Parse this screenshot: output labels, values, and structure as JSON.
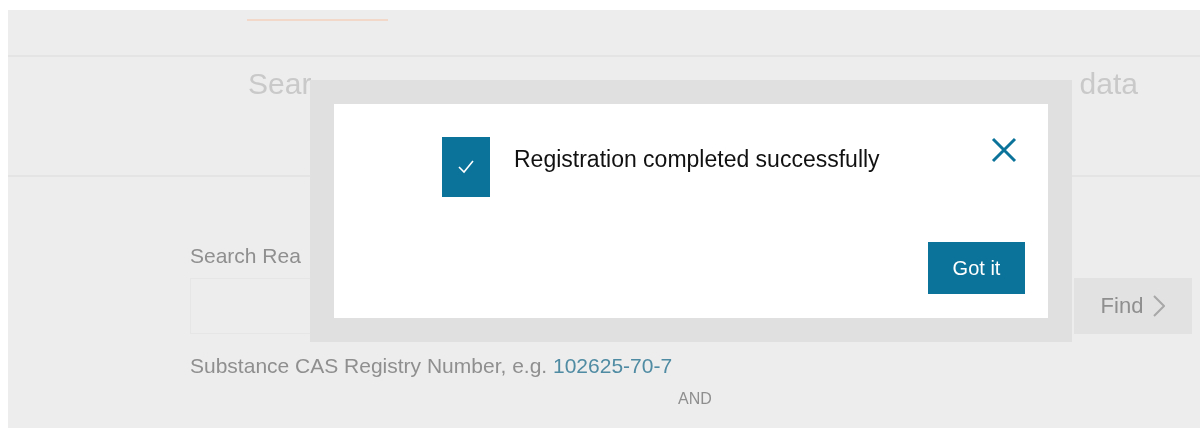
{
  "nav": {
    "tabs": [
      {
        "selected": true
      }
    ]
  },
  "hero": {
    "heading_start": "Sear",
    "heading_end": "data"
  },
  "search": {
    "label": "Search Rea",
    "find_button": "Find",
    "hint": "Substance CAS Registry Number, e.g.",
    "hint_link": "102625-70-7",
    "connector": "AND"
  },
  "dialog": {
    "checked": true,
    "message": "Registration completed successfully",
    "button": "Got it"
  }
}
